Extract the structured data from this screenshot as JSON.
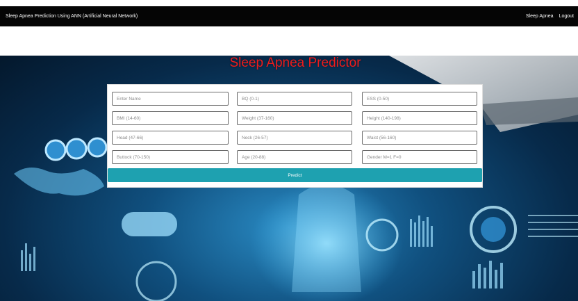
{
  "header": {
    "app_title": "Sleep Apnea Prediction Using ANN (Artificial Neural Network)",
    "nav": [
      "Sleep Apnea",
      "Logout"
    ]
  },
  "page": {
    "title": "Sleep Apnea Predictor"
  },
  "form": {
    "fields": [
      {
        "placeholder": "Enter Name",
        "value": ""
      },
      {
        "placeholder": "BQ (0-1)",
        "value": ""
      },
      {
        "placeholder": "ESS (0-50)",
        "value": ""
      },
      {
        "placeholder": "BMI (14-60)",
        "value": ""
      },
      {
        "placeholder": "Weight (37-160)",
        "value": ""
      },
      {
        "placeholder": "Height (140-198)",
        "value": ""
      },
      {
        "placeholder": "Head (47-66)",
        "value": ""
      },
      {
        "placeholder": "Neck (26-57)",
        "value": ""
      },
      {
        "placeholder": "Waist (56-160)",
        "value": ""
      },
      {
        "placeholder": "Buttock (70-150)",
        "value": ""
      },
      {
        "placeholder": "Age (20-88)",
        "value": ""
      },
      {
        "placeholder": "Gender M=1 F=0",
        "value": ""
      }
    ],
    "submit_label": "Predict"
  },
  "colors": {
    "header_bg": "#050505",
    "title_red": "#ee1c1c",
    "predict_button": "#1ea1b0",
    "hero_blue": "#10507f"
  }
}
